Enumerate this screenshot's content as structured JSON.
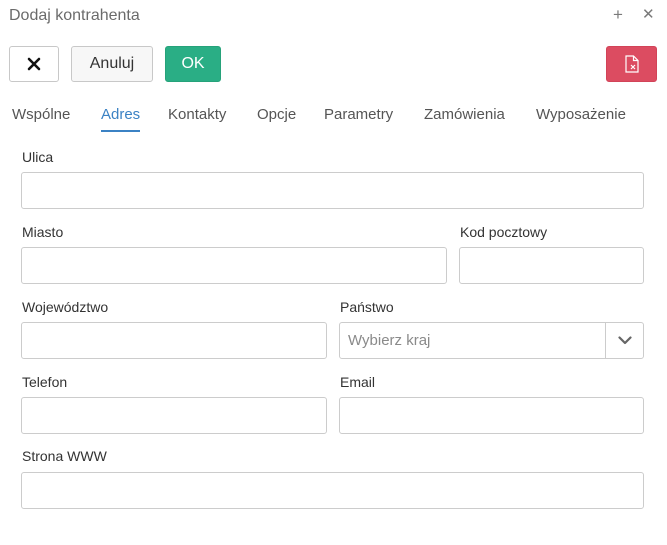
{
  "window": {
    "title": "Dodaj kontrahenta",
    "plus_icon": "plus-icon",
    "close_icon": "close-icon"
  },
  "toolbar": {
    "close_icon": "x-icon",
    "cancel_label": "Anuluj",
    "ok_label": "OK",
    "delete_icon": "delete-document-icon",
    "colors": {
      "ok": "#2aae85",
      "delete": "#dc4c61"
    }
  },
  "tabs": [
    {
      "label": "Wspólne"
    },
    {
      "label": "Adres"
    },
    {
      "label": "Kontakty"
    },
    {
      "label": "Opcje"
    },
    {
      "label": "Parametry"
    },
    {
      "label": "Zamówienia"
    },
    {
      "label": "Wyposażenie"
    }
  ],
  "active_tab": "Adres",
  "form": {
    "street": {
      "label": "Ulica",
      "value": ""
    },
    "city": {
      "label": "Miasto",
      "value": ""
    },
    "postal_code": {
      "label": "Kod pocztowy",
      "value": ""
    },
    "province": {
      "label": "Województwo",
      "value": ""
    },
    "country": {
      "label": "Państwo",
      "placeholder": "Wybierz kraj"
    },
    "phone": {
      "label": "Telefon",
      "value": ""
    },
    "email": {
      "label": "Email",
      "value": ""
    },
    "website": {
      "label": "Strona WWW",
      "value": ""
    }
  }
}
